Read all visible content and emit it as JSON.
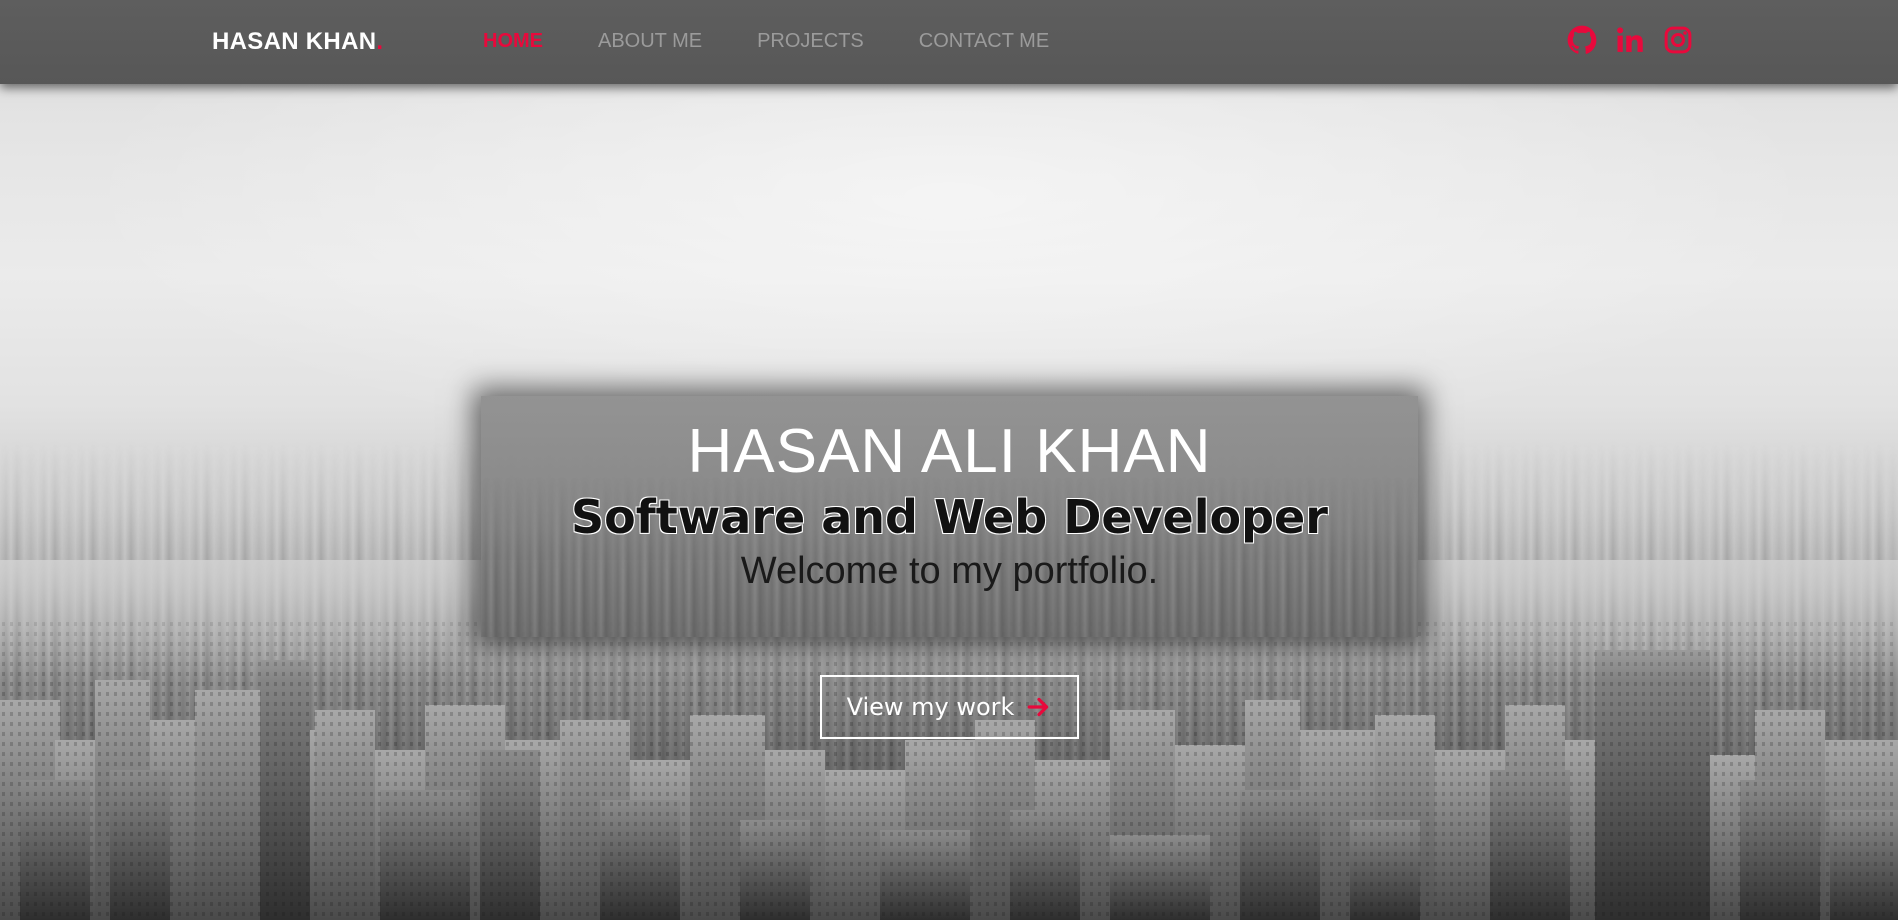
{
  "brand": {
    "name": "HASAN KHAN",
    "dot": "."
  },
  "nav": {
    "items": [
      {
        "label": "HOME",
        "active": true
      },
      {
        "label": "ABOUT ME",
        "active": false
      },
      {
        "label": "PROJECTS",
        "active": false
      },
      {
        "label": "CONTACT ME",
        "active": false
      }
    ]
  },
  "socials": {
    "items": [
      {
        "icon": "github-icon"
      },
      {
        "icon": "linkedin-icon"
      },
      {
        "icon": "instagram-icon"
      }
    ]
  },
  "hero": {
    "name": "HASAN ALI KHAN",
    "role": "Software and Web Developer",
    "welcome": "Welcome to my portfolio."
  },
  "cta": {
    "label": "View my work",
    "icon": "arrow-right-icon"
  },
  "colors": {
    "accent": "#e8093c",
    "navbar": "#5a5a5a",
    "nav_inactive": "#9b9b9b",
    "text_light": "#ffffff"
  }
}
